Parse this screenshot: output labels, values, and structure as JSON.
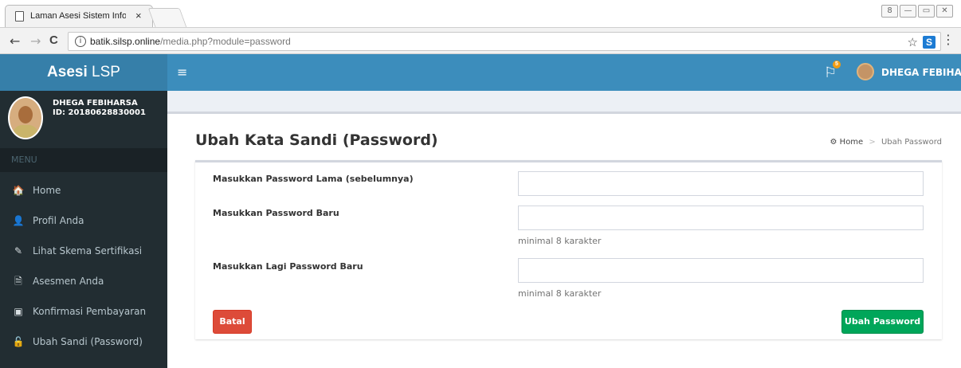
{
  "browser": {
    "tab_title": "Laman Asesi Sistem Inform",
    "tab_close": "×",
    "url_domain": "batik.silsp.online",
    "url_path": "/media.php?module=password",
    "back": "←",
    "forward": "→",
    "reload": "C",
    "info": "i",
    "star": "☆",
    "ext": "S",
    "menu": "⋮",
    "win_user": "8",
    "win_min": "—",
    "win_max": "▭",
    "win_close": "✕"
  },
  "header": {
    "brand_bold": "Asesi",
    "brand_rest": " LSP",
    "hamburger": "≡",
    "flag": "⚐",
    "flag_badge": "5",
    "user_name": "DHEGA FEBIHARSA"
  },
  "sidebar": {
    "user_name": "DHEGA FEBIHARSA",
    "user_id": "ID: 20180628830001",
    "menu_header": "MENU",
    "items": [
      {
        "icon": "🏠",
        "label": "Home"
      },
      {
        "icon": "👤",
        "label": "Profil Anda"
      },
      {
        "icon": "✎",
        "label": "Lihat Skema Sertifikasi"
      },
      {
        "icon": "🗎",
        "label": "Asesmen Anda"
      },
      {
        "icon": "▣",
        "label": "Konfirmasi Pembayaran"
      },
      {
        "icon": "🔓",
        "label": "Ubah Sandi (Password)"
      }
    ]
  },
  "content": {
    "page_title": "Ubah Kata Sandi (Password)",
    "breadcrumb_home": "Home",
    "breadcrumb_sep": ">",
    "breadcrumb_current": "Ubah Password",
    "fields": {
      "old_label": "Masukkan Password Lama (sebelumnya)",
      "new_label": "Masukkan Password Baru",
      "new_help": "minimal 8 karakter",
      "confirm_label": "Masukkan Lagi Password Baru",
      "confirm_help": "minimal 8 karakter"
    },
    "cancel_label": "Batal",
    "submit_label": "Ubah Password"
  },
  "colors": {
    "header": "#3c8dbc",
    "brand": "#367fa9",
    "sidebar": "#222d32",
    "danger": "#dd4b39",
    "success": "#00a65a"
  }
}
